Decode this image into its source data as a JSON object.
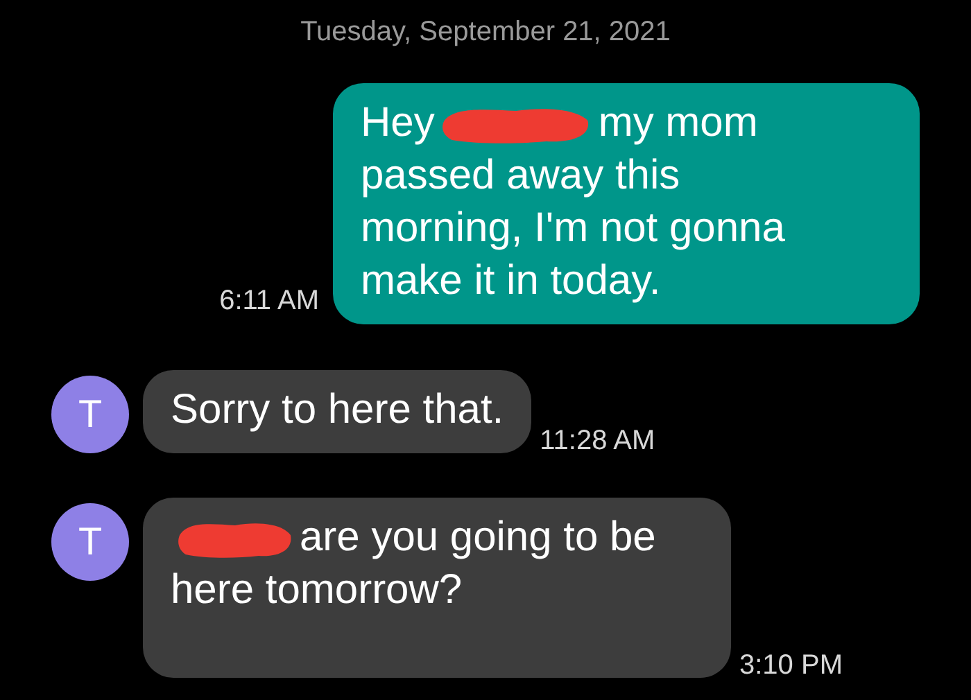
{
  "date_separator": "Tuesday, September 21, 2021",
  "messages": [
    {
      "kind": "outgoing",
      "text_before": "Hey",
      "redacted": true,
      "text_after": "my mom passed away this morning, I'm not gonna make it in today.",
      "time": "6:11 AM"
    },
    {
      "kind": "incoming",
      "avatar_letter": "T",
      "text_before": "Sorry to here that.",
      "time": "11:28 AM"
    },
    {
      "kind": "incoming",
      "avatar_letter": "T",
      "redacted": true,
      "text_after": "are you going to be here tomorrow?",
      "time": "3:10 PM"
    }
  ]
}
